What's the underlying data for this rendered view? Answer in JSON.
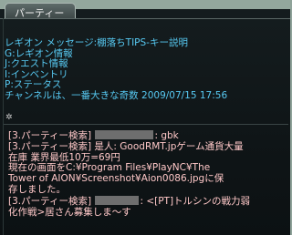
{
  "window": {
    "tab_label": "パーティー"
  },
  "system_messages": [
    "レギオン メッセージ:棚落ちTIPS-キー説明",
    "G:レギオン情報",
    "J:クエスト情報",
    "I:インベントリ",
    "P:ステータス",
    "チャンネルは、一番大きな奇数 2009/07/15 17:56"
  ],
  "chat": {
    "line1_prefix": "[3.パーティー検索]",
    "line1_suffix": ": gbk",
    "line2": "[3.パーティー検索] 是人: GoodRMT.jpゲーム通貨大量",
    "line3": "在庫 業界最低10万=69円",
    "line4": "現在の画面をC:¥Program Files¥PlayNC¥The",
    "line5": "Tower of AION¥Screenshot¥Aion0086.jpgに保",
    "line6": "存しました。",
    "line7_prefix": "[3.パーティー検索]",
    "line7_suffix": ": <[PT]トルシンの戦力弱",
    "line8": "化作戦>居さん募集しま～す"
  },
  "icons": {
    "settings": "gear-icon"
  },
  "colors": {
    "system_text": "#57c9f2",
    "chat_text": "#ffc8c8",
    "background": "#0f1517"
  }
}
